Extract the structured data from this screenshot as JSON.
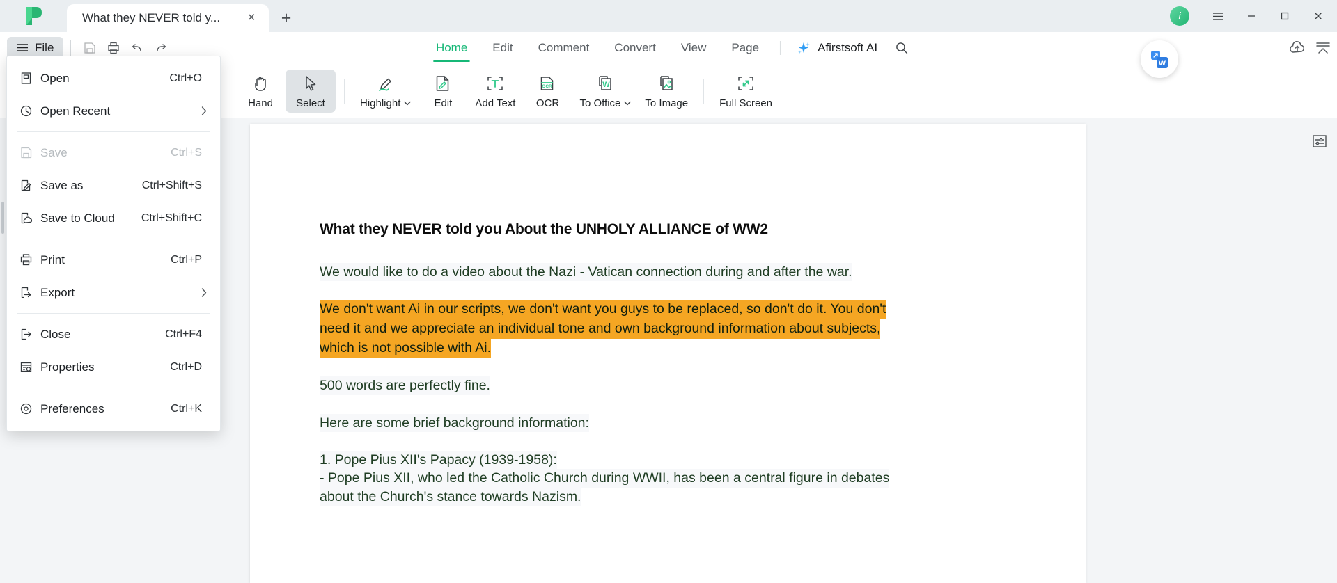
{
  "titlebar": {
    "logo": "afirstsoft-logo",
    "tab_title": "What they NEVER told y...",
    "close_tab_label": "×",
    "new_tab_label": "+",
    "avatar_initial": "i",
    "menu_icon": "hamburger-icon",
    "minimize_label": "—",
    "maximize_label": "☐",
    "close_label": "×"
  },
  "ribbon": {
    "file_label": "File",
    "quick_access": [
      {
        "name": "save-icon",
        "disabled": true
      },
      {
        "name": "print-icon",
        "disabled": false
      },
      {
        "name": "undo-icon",
        "disabled": false
      },
      {
        "name": "redo-icon",
        "disabled": false
      }
    ],
    "tabs": [
      {
        "label": "Home",
        "active": true
      },
      {
        "label": "Edit",
        "active": false
      },
      {
        "label": "Comment",
        "active": false
      },
      {
        "label": "Convert",
        "active": false
      },
      {
        "label": "View",
        "active": false
      },
      {
        "label": "Page",
        "active": false
      }
    ],
    "ai_label": "Afirstsoft AI",
    "search_icon": "search-icon",
    "cloud_icon": "cloud-upload-icon",
    "collapse_icon": "collapse-ribbon-icon"
  },
  "toolbar": {
    "tools": [
      {
        "label": "Hand",
        "icon": "hand-icon",
        "active": false,
        "dropdown": false
      },
      {
        "label": "Select",
        "icon": "cursor-arrow-icon",
        "active": true,
        "dropdown": false
      },
      {
        "label": "Highlight",
        "icon": "highlighter-pen-icon",
        "active": false,
        "dropdown": true
      },
      {
        "label": "Edit",
        "icon": "edit-document-icon",
        "active": false,
        "dropdown": false
      },
      {
        "label": "Add Text",
        "icon": "add-text-icon",
        "active": false,
        "dropdown": false
      },
      {
        "label": "OCR",
        "icon": "ocr-icon",
        "active": false,
        "dropdown": false
      },
      {
        "label": "To Office",
        "icon": "to-office-word-icon",
        "active": false,
        "dropdown": true
      },
      {
        "label": "To Image",
        "icon": "to-image-icon",
        "active": false,
        "dropdown": false
      },
      {
        "label": "Full Screen",
        "icon": "full-screen-icon",
        "active": false,
        "dropdown": false
      }
    ]
  },
  "file_menu": {
    "items": [
      {
        "label": "Open",
        "shortcut": "Ctrl+O",
        "icon": "open-file-icon",
        "disabled": false,
        "submenu": false,
        "separator_after": false
      },
      {
        "label": "Open Recent",
        "shortcut": "",
        "icon": "clock-recent-icon",
        "disabled": false,
        "submenu": true,
        "separator_after": true
      },
      {
        "label": "Save",
        "shortcut": "Ctrl+S",
        "icon": "save-disk-icon",
        "disabled": true,
        "submenu": false,
        "separator_after": false
      },
      {
        "label": "Save as",
        "shortcut": "Ctrl+Shift+S",
        "icon": "save-as-icon",
        "disabled": false,
        "submenu": false,
        "separator_after": false
      },
      {
        "label": "Save to Cloud",
        "shortcut": "Ctrl+Shift+C",
        "icon": "save-cloud-icon",
        "disabled": false,
        "submenu": false,
        "separator_after": true
      },
      {
        "label": "Print",
        "shortcut": "Ctrl+P",
        "icon": "print-icon",
        "disabled": false,
        "submenu": false,
        "separator_after": false
      },
      {
        "label": "Export",
        "shortcut": "",
        "icon": "export-icon",
        "disabled": false,
        "submenu": true,
        "separator_after": true
      },
      {
        "label": "Close",
        "shortcut": "Ctrl+F4",
        "icon": "close-document-icon",
        "disabled": false,
        "submenu": false,
        "separator_after": false
      },
      {
        "label": "Properties",
        "shortcut": "Ctrl+D",
        "icon": "properties-icon",
        "disabled": false,
        "submenu": false,
        "separator_after": true
      },
      {
        "label": "Preferences",
        "shortcut": "Ctrl+K",
        "icon": "preferences-gear-icon",
        "disabled": false,
        "submenu": false,
        "separator_after": false
      }
    ]
  },
  "document": {
    "title": "What they NEVER told you About the UNHOLY ALLIANCE of WW2",
    "paragraph_1": "We would like to do a video about the Nazi - Vatican connection during and after the war.",
    "highlight_lines": [
      "We don't want Ai in our scripts, we don't want you guys to be replaced, so don't do it. You don't",
      "need it and we appreciate an individual tone and own background information about subjects,",
      "which is not possible with Ai."
    ],
    "highlight_color": "#f5a623",
    "paragraph_2": "500 words are perfectly fine.",
    "paragraph_3": "Here are some brief background information:",
    "paragraph_4_line1": "1. Pope Pius XII's Papacy (1939-1958):",
    "paragraph_4_line2": "- Pope Pius XII, who led the Catholic Church during WWII, has been a central figure in debates",
    "paragraph_4_line3": "about the Church's stance towards Nazism."
  },
  "floating": {
    "word_badge_icon": "convert-to-word-badge-icon"
  },
  "right_rail": {
    "items": [
      {
        "icon": "properties-panel-icon"
      }
    ]
  },
  "colors": {
    "accent_green": "#16b877",
    "highlight_orange": "#f5a623",
    "doc_text_green": "#1f3d23",
    "titlebar_bg": "#eaeef1"
  }
}
